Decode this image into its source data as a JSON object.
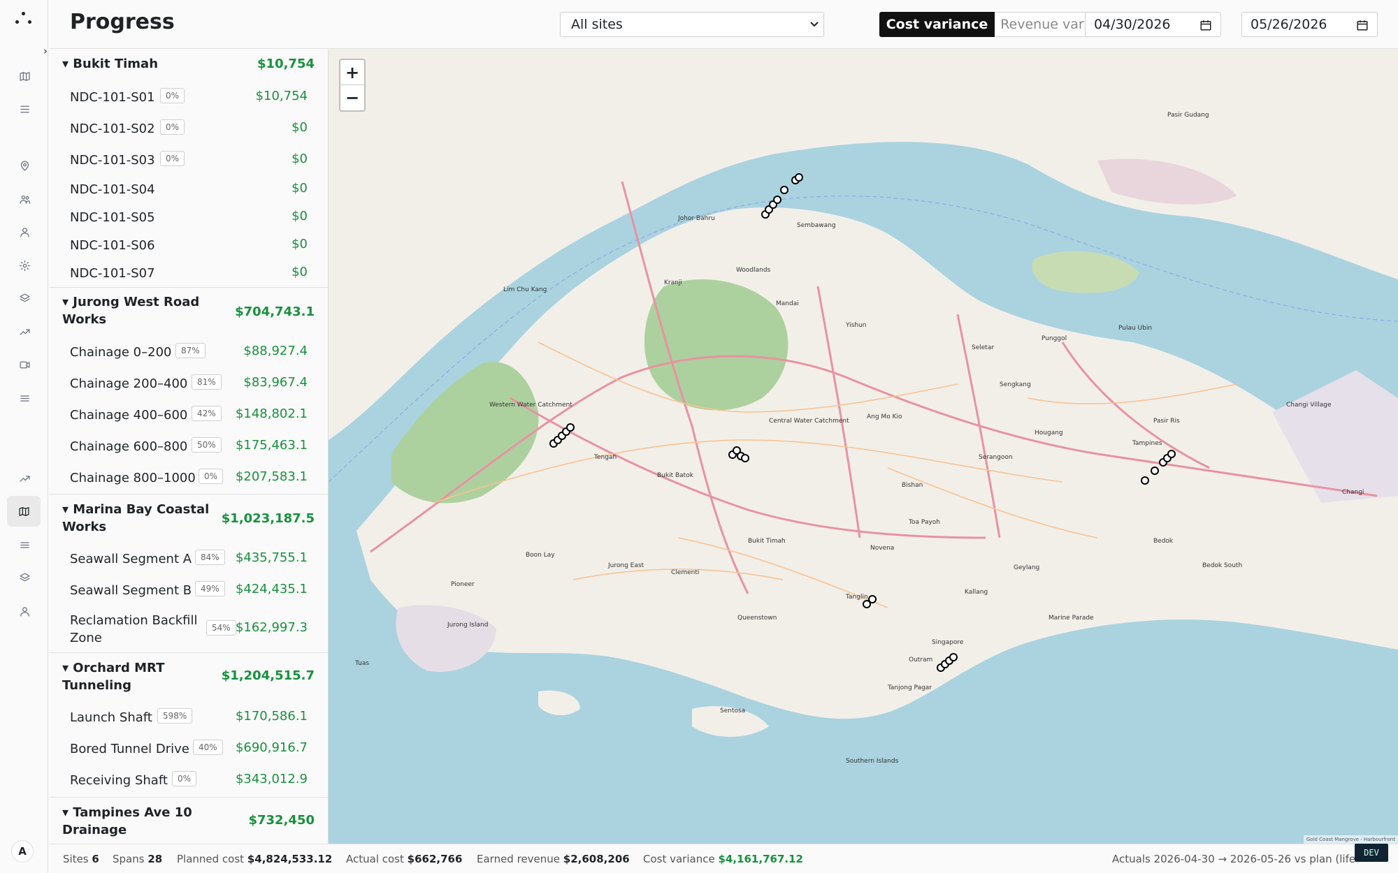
{
  "header": {
    "title": "Progress",
    "site_select": "All sites",
    "seg_cost": "Cost variance",
    "seg_revenue": "Revenue variance",
    "date_from": "04/30/2026",
    "date_sep": "–",
    "date_to": "05/26/2026"
  },
  "rail": {
    "avatar": "A",
    "icons": [
      "map-icon",
      "list-icon",
      "pin-icon",
      "users-icon",
      "user-icon",
      "gear-icon",
      "layers-icon",
      "trend-icon",
      "video-icon",
      "menu-icon",
      "trend-icon",
      "map-icon",
      "menu-icon",
      "layers-icon",
      "user-icon"
    ]
  },
  "panel": {
    "toggle": "›",
    "groups": [
      {
        "name": "▾ Bukit Timah",
        "value": "$10,754",
        "rows": [
          {
            "name": "NDC-101-S01",
            "pct": "0%",
            "value": "$10,754"
          },
          {
            "name": "NDC-101-S02",
            "pct": "0%",
            "value": "$0"
          },
          {
            "name": "NDC-101-S03",
            "pct": "0%",
            "value": "$0"
          },
          {
            "name": "NDC-101-S04",
            "pct": "",
            "value": "$0"
          },
          {
            "name": "NDC-101-S05",
            "pct": "",
            "value": "$0"
          },
          {
            "name": "NDC-101-S06",
            "pct": "",
            "value": "$0"
          },
          {
            "name": "NDC-101-S07",
            "pct": "",
            "value": "$0"
          }
        ]
      },
      {
        "name": "▾ Jurong West Road Works",
        "value": "$704,743.1",
        "rows": [
          {
            "name": "Chainage 0–200",
            "pct": "87%",
            "value": "$88,927.4"
          },
          {
            "name": "Chainage 200–400",
            "pct": "81%",
            "value": "$83,967.4"
          },
          {
            "name": "Chainage 400–600",
            "pct": "42%",
            "value": "$148,802.1"
          },
          {
            "name": "Chainage 600–800",
            "pct": "50%",
            "value": "$175,463.1"
          },
          {
            "name": "Chainage 800–1000",
            "pct": "0%",
            "value": "$207,583.1"
          }
        ]
      },
      {
        "name": "▾ Marina Bay Coastal Works",
        "value": "$1,023,187.5",
        "rows": [
          {
            "name": "Seawall Segment A",
            "pct": "84%",
            "value": "$435,755.1"
          },
          {
            "name": "Seawall Segment B",
            "pct": "49%",
            "value": "$424,435.1"
          },
          {
            "name": "Reclamation Backfill Zone",
            "pct": "54%",
            "value": "$162,997.3"
          }
        ]
      },
      {
        "name": "▾ Orchard MRT Tunneling",
        "value": "$1,204,515.7",
        "rows": [
          {
            "name": "Launch Shaft",
            "pct": "598%",
            "value": "$170,586.1"
          },
          {
            "name": "Bored Tunnel Drive",
            "pct": "40%",
            "value": "$690,916.7"
          },
          {
            "name": "Receiving Shaft",
            "pct": "0%",
            "value": "$343,012.9"
          }
        ]
      },
      {
        "name": "▾ Tampines Ave 10 Drainage",
        "value": "$732,450",
        "rows": []
      }
    ]
  },
  "map": {
    "zoom_in": "+",
    "zoom_out": "−",
    "attribution": "Gold Coast Mangrove - Harbourfront",
    "labels": [
      "Johor Bahru",
      "Woodlands",
      "Sembawang",
      "Yishun",
      "Sengkang",
      "Punggol",
      "Tampines",
      "Bedok",
      "Changi",
      "Jurong East",
      "Bukit Batok",
      "Bukit Timah",
      "Clementi",
      "Queenstown",
      "Singapore",
      "Sentosa",
      "Tanjong Pagar",
      "Pasir Ris",
      "Pasir Gudang",
      "Kallang",
      "Geylang",
      "Toa Payoh",
      "Bishan",
      "Ang Mo Kio",
      "Hougang",
      "Serangoon",
      "Pulau Ubin",
      "Jurong Island",
      "Tuas",
      "Pioneer",
      "Boon Lay",
      "Kranji",
      "Mandai",
      "Lim Chu Kang",
      "Tengah",
      "Western Water Catchment",
      "Central Water Catchment",
      "Southern Islands",
      "Marine Parade",
      "Novena",
      "Tanglin",
      "Outram",
      "Bedok South",
      "Changi Village",
      "Seletar"
    ]
  },
  "footer": {
    "sites_label": "Sites",
    "sites_value": "6",
    "spans_label": "Spans",
    "spans_value": "28",
    "planned_label": "Planned cost",
    "planned_value": "$4,824,533.12",
    "actual_label": "Actual cost",
    "actual_value": "$662,766",
    "earned_label": "Earned revenue",
    "earned_value": "$2,608,206",
    "variance_label": "Cost variance",
    "variance_value": "$4,161,767.12",
    "actuals": "Actuals 2026-04-30 → 2026-05-26 vs plan (life"
  },
  "dev_badge": "DEV",
  "colors": {
    "accent": "#111111",
    "positive": "#17913c",
    "water": "#aad3df",
    "land": "#f2efe9",
    "park": "#add19e"
  }
}
